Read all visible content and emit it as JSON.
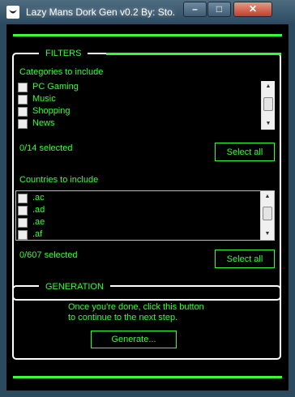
{
  "window": {
    "title": "Lazy Mans Dork Gen v0.2 By: Sto...",
    "min_label": "–",
    "max_label": "□",
    "close_label": "✕"
  },
  "filters": {
    "title": "FILTERS",
    "categories_label": "Categories to include",
    "categories": [
      "PC Gaming",
      "Music",
      "Shopping",
      "News"
    ],
    "categories_selected": "0/14 selected",
    "categories_select_all": "Select all",
    "countries_label": "Countries to include",
    "countries": [
      ".ac",
      ".ad",
      ".ae",
      ".af"
    ],
    "countries_selected": "0/607 selected",
    "countries_select_all": "Select all"
  },
  "generation": {
    "title": "GENERATION",
    "instructions_line1": "Once you're done, click this button",
    "instructions_line2": "to continue to the next step.",
    "generate_button": "Generate..."
  },
  "colors": {
    "accent": "#33ff33",
    "background": "#000000",
    "frame": "#2b4a5e",
    "close": "#c0402a"
  }
}
